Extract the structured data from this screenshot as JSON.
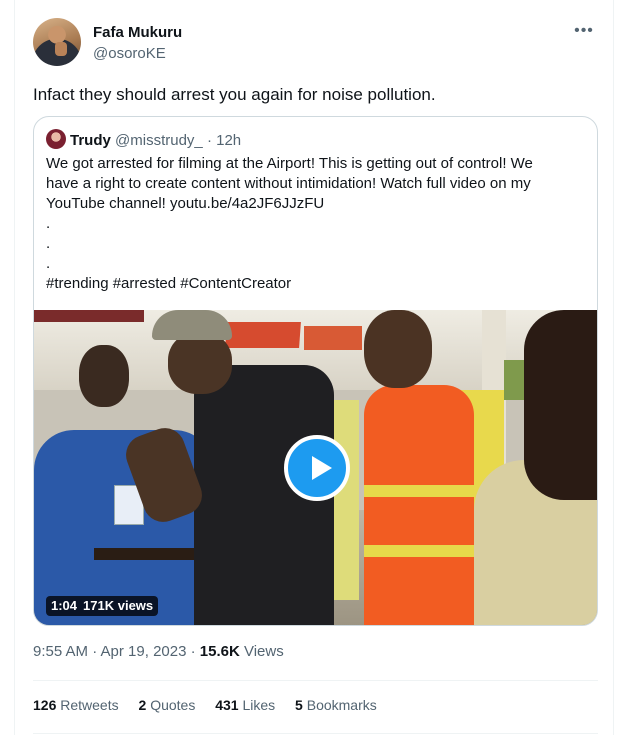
{
  "author": {
    "display_name": "Fafa Mukuru",
    "handle": "@osoroKE",
    "more_icon": "more-horizontal-icon"
  },
  "tweet": {
    "text": "Infact they should arrest you again for noise pollution."
  },
  "quoted": {
    "display_name": "Trudy",
    "handle": "@misstrudy_",
    "separator": "·",
    "time": "12h",
    "lines": [
      "We got arrested for filming at the Airport!  This is getting out of control! We",
      "have a right to create content without intimidation! Watch full video on my",
      "YouTube channel! youtu.be/4a2JF6JJzFU",
      ".",
      ".",
      ".",
      "#trending #arrested #ContentCreator"
    ],
    "video": {
      "duration": "1:04",
      "views": "171K views"
    }
  },
  "meta": {
    "time": "9:55 AM · Apr 19, 2023 · ",
    "views_count": "15.6K",
    "views_label": " Views"
  },
  "stats": {
    "retweets_count": "126",
    "retweets_label": "Retweets",
    "quotes_count": "2",
    "quotes_label": "Quotes",
    "likes_count": "431",
    "likes_label": "Likes",
    "bookmarks_count": "5",
    "bookmarks_label": "Bookmarks"
  },
  "colors": {
    "accent": "#1d9bf0",
    "secondary_text": "#536471",
    "primary_text": "#0f1419",
    "border": "#cfd9de"
  }
}
